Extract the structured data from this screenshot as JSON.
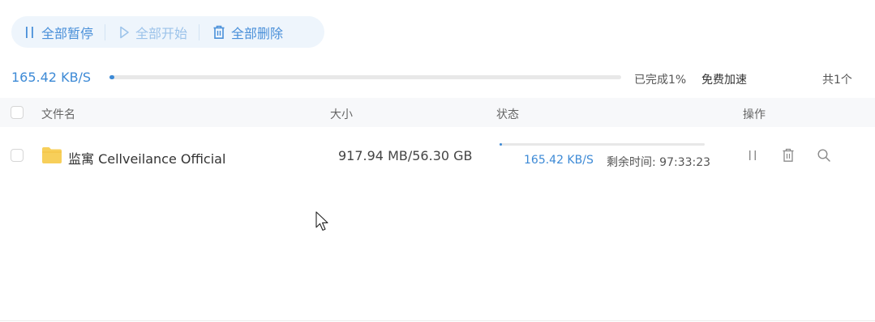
{
  "toolbar": {
    "pause_all": "全部暂停",
    "start_all": "全部开始",
    "delete_all": "全部删除"
  },
  "summary": {
    "speed": "165.42 KB/S",
    "progress_percent": 1,
    "completed": "已完成1%",
    "boost": "免费加速",
    "total": "共1个"
  },
  "table": {
    "headers": {
      "name": "文件名",
      "size": "大小",
      "status": "状态",
      "actions": "操作"
    },
    "rows": [
      {
        "name": "监寓 Cellveilance Official",
        "size": "917.94 MB/56.30 GB",
        "progress_percent": 1,
        "speed": "165.42 KB/S",
        "remaining": "剩余时间: 97:33:23"
      }
    ]
  },
  "colors": {
    "accent": "#3d8ad6",
    "toolbar_bg": "#eef5fc",
    "folder": "#f7cf5a"
  }
}
